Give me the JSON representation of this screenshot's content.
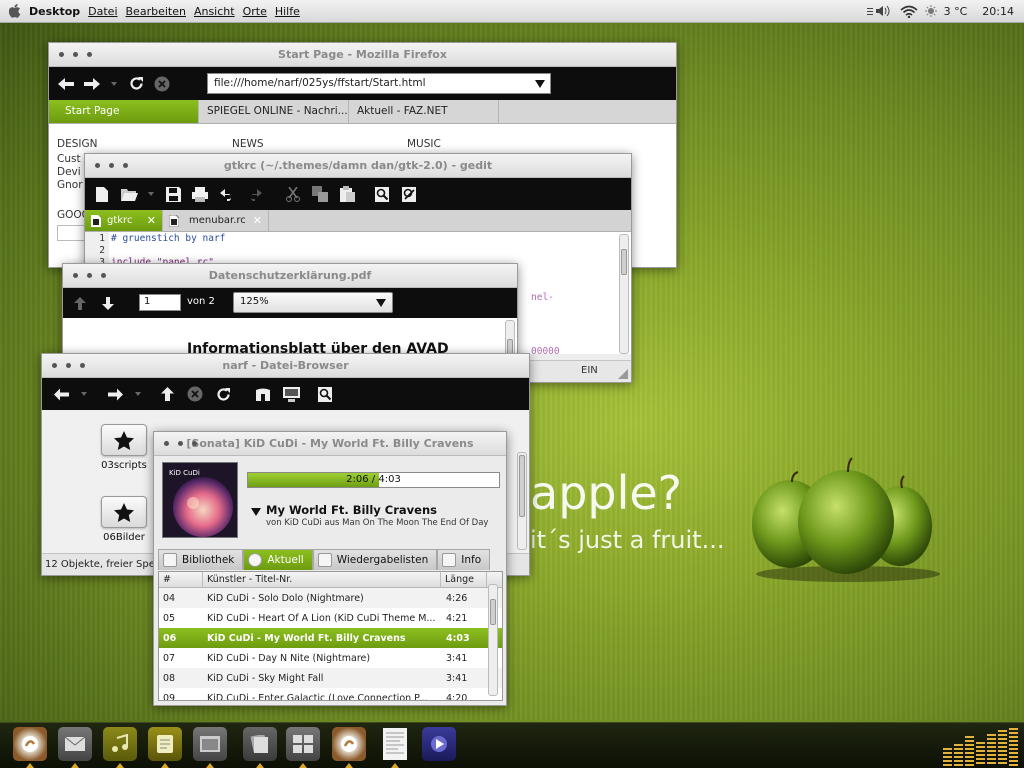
{
  "topbar": {
    "menus": [
      "Desktop",
      "Datei",
      "Bearbeiten",
      "Ansicht",
      "Orte",
      "Hilfe"
    ],
    "temperature": "3 °C",
    "time": "20:14"
  },
  "wallpaper": {
    "headline": "apple?",
    "tagline": "it´s just a fruit..."
  },
  "firefox": {
    "title": "Start Page - Mozilla Firefox",
    "url": "file:///home/narf/025ys/ffstart/Start.html",
    "tabs": [
      "Start Page",
      "SPIEGEL ONLINE - Nachri...",
      "Aktuell - FAZ.NET"
    ],
    "columns": [
      "DESIGN",
      "NEWS",
      "MUSIC"
    ],
    "design_items": [
      "Cust",
      "Devi",
      "Gnor"
    ],
    "search_label": "GOOG"
  },
  "gedit": {
    "title": "gtkrc (~/.themes/damn dan/gtk-2.0) - gedit",
    "tabs": [
      "gtkrc",
      "menubar.rc"
    ],
    "line_numbers": [
      "1",
      "2",
      "3"
    ],
    "code_lines": [
      "# gruenstich by narf",
      "",
      "include \"panel.rc\""
    ],
    "code_fragment_right": "nel-",
    "code_fragment_bottom": "00000",
    "status_ins": "EIN"
  },
  "evince": {
    "title": "Datenschutzerklärung.pdf",
    "page": "1",
    "of_pages": "von 2",
    "zoom": "125%",
    "doc_heading": "Informationsblatt über den AVAD"
  },
  "nautilus": {
    "title": "narf - Datei-Browser",
    "folders": [
      "03scripts",
      "06Bilder"
    ],
    "status": "12 Objekte, freier Spei"
  },
  "sonata": {
    "title": "[Sonata] KiD CuDi - My World Ft. Billy Cravens",
    "progress_text": "2:06 / 4:03",
    "progress_fraction": 0.52,
    "song_title": "My World Ft. Billy Cravens",
    "song_subtitle": "von KiD CuDi aus Man On The Moon The End Of Day",
    "album_art_text": "KiD CuDi",
    "tabs": [
      "Bibliothek",
      "Aktuell",
      "Wiedergabelisten",
      "Info"
    ],
    "columns": [
      "#",
      "Künstler - Titel-Nr.",
      "Länge"
    ],
    "rows": [
      {
        "n": "04",
        "title": "KiD CuDi - Solo Dolo  (Nightmare)",
        "len": "4:26"
      },
      {
        "n": "05",
        "title": "KiD CuDi - Heart Of A Lion (KiD CuDi Theme M...",
        "len": "4:21"
      },
      {
        "n": "06",
        "title": "KiD CuDi - My World Ft. Billy Cravens",
        "len": "4:03"
      },
      {
        "n": "07",
        "title": "KiD CuDi - Day N Nite  (Nightmare)",
        "len": "3:41"
      },
      {
        "n": "08",
        "title": "KiD CuDi - Sky Might Fall",
        "len": "3:41"
      },
      {
        "n": "09",
        "title": "KiD CuDi - Enter Galactic (Love Connection P...",
        "len": "4:20"
      }
    ],
    "current_row": 2
  },
  "dock": {
    "items": [
      "firefox-icon",
      "mail-icon",
      "music-icon",
      "notes-icon",
      "window-icon",
      "files-icon",
      "workspace-icon",
      "sonata-icon",
      "document-icon",
      "media-player-icon"
    ],
    "eq_levels": [
      0.45,
      0.55,
      0.75,
      0.6,
      0.8,
      0.9,
      0.95
    ]
  },
  "colors": {
    "accent_green": "#7cae17",
    "toolbar_black": "#0d0d0d",
    "dock_gold": "#d9a62a"
  }
}
